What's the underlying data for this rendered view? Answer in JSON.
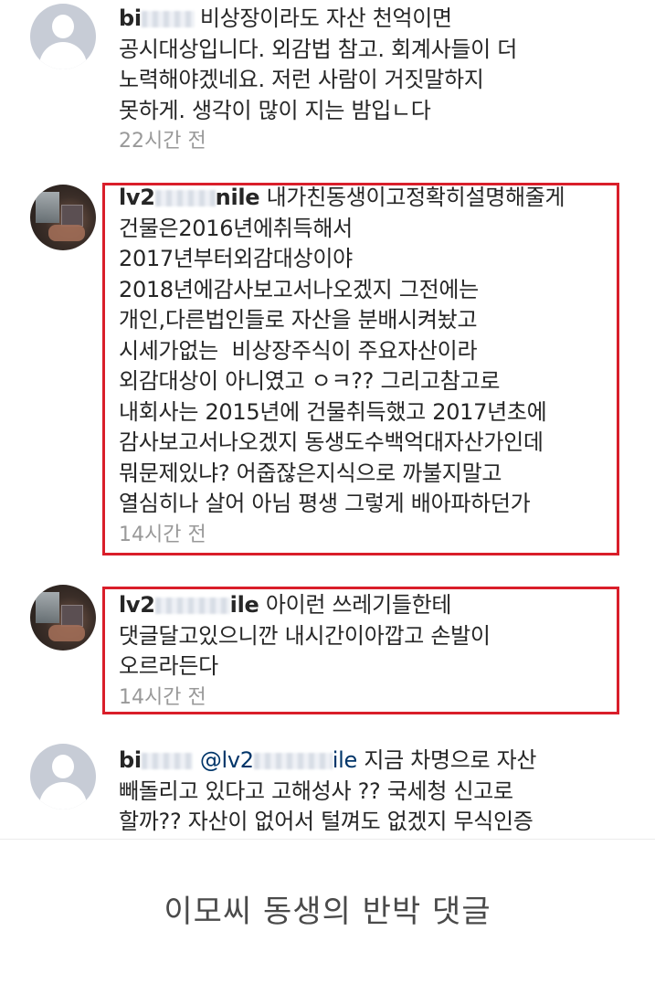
{
  "comments": [
    {
      "username": "bi",
      "lines": [
        "비상장이라도 자산 천억이면",
        "공시대상입니다. 외감법 참고. 회계사들이 더",
        "노력해야겠네요. 저런 사람이 거짓말하지",
        "못하게. 생각이 많이 지는 밤입ㄴ다"
      ],
      "time": "22시간 전",
      "avatar": "default-avatar"
    },
    {
      "username_prefix": "lv2",
      "username_suffix": "nile",
      "lines": [
        "내가친동생이고정확히설명해줄게",
        "건물은2016년에취득해서",
        "2017년부터외감대상이야",
        "2018년에감사보고서나오겠지 그전에는",
        "개인,다른법인들로 자산을 분배시켜놨고",
        "시세가없는  비상장주식이 주요자산이라",
        "외감대상이 아니였고 ㅇㅋ?? 그리고참고로",
        "내회사는 2015년에 건물취득했고 2017년초에",
        "감사보고서나오겠지 동생도수백억대자산가인데",
        "뭐문제있냐? 어줍잖은지식으로 까불지말고",
        "열심히나 살어 아님 평생 그렇게 배아파하던가"
      ],
      "time": "14시간 전",
      "avatar": "photo-avatar"
    },
    {
      "username_prefix": "lv2",
      "username_suffix": "ile",
      "lines": [
        "아이런 쓰레기들한테",
        "댓글달고있으니깐 내시간이아깝고 손발이",
        "오르라든다"
      ],
      "time": "14시간 전",
      "avatar": "photo-avatar"
    },
    {
      "username": "bi",
      "mention_prefix": "@lv2",
      "mention_suffix": "ile",
      "lines": [
        "지금 차명으로 자산",
        "빼돌리고 있다고 고해성사 ?? 국세청 신고로",
        "할까?? 자산이 없어서 털껴도 없겠지 무식인증"
      ],
      "avatar": "default-avatar"
    }
  ],
  "caption": "이모씨 동생의 반박 댓글",
  "colors": {
    "highlight": "#d91e2a",
    "time": "#999999",
    "mention": "#003569"
  }
}
